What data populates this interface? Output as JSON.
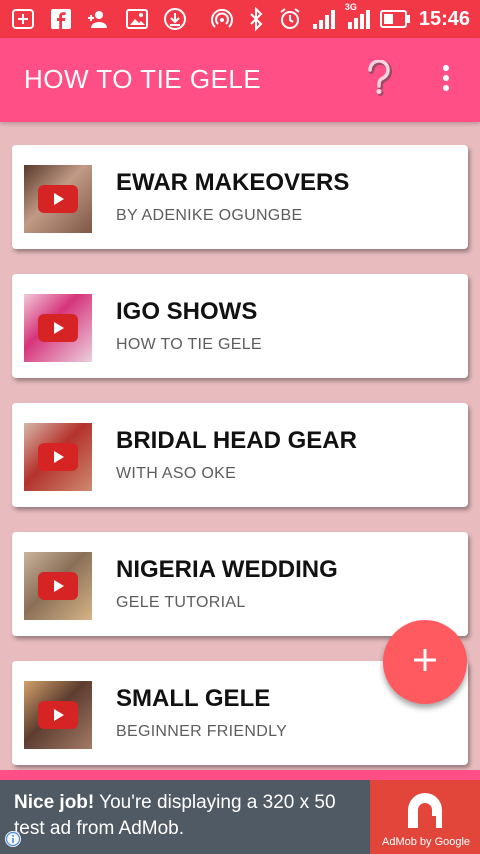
{
  "status_bar": {
    "time": "15:46",
    "network_label": "3G",
    "icons": [
      "add-box-icon",
      "facebook-icon",
      "person-add-icon",
      "image-icon",
      "download-icon",
      "hotspot-icon",
      "bluetooth-icon",
      "alarm-icon",
      "signal-icon",
      "signal-3g-icon",
      "battery-icon"
    ]
  },
  "app_bar": {
    "title": "HOW TO TIE GELE",
    "help_icon": "help-icon",
    "more_icon": "more-vert-icon"
  },
  "videos": [
    {
      "title": "EWAR MAKEOVERS",
      "subtitle": "BY ADENIKE OGUNGBE",
      "thumb_color": "#8a6a5a"
    },
    {
      "title": "IGO SHOWS",
      "subtitle": "HOW TO TIE GELE",
      "thumb_color": "#d24a8a"
    },
    {
      "title": "BRIDAL HEAD GEAR",
      "subtitle": "WITH ASO OKE",
      "thumb_color": "#b8463a"
    },
    {
      "title": "NIGERIA WEDDING",
      "subtitle": "GELE TUTORIAL",
      "thumb_color": "#a08060"
    },
    {
      "title": "SMALL GELE",
      "subtitle": "BEGINNER FRIENDLY",
      "thumb_color": "#7a5a48"
    }
  ],
  "fab": {
    "icon": "plus-icon"
  },
  "ad": {
    "headline": "Nice job!",
    "body": " You're displaying a 320 x 50 test ad from AdMob.",
    "brand": "AdMob by Google",
    "info_icon": "info-icon"
  },
  "colors": {
    "status_bar": "#f23847",
    "app_bar": "#ff4f86",
    "background": "#e8bcbf",
    "fab": "#ff5a5f",
    "ad_background": "#505a64",
    "ad_logo": "#e2463b"
  }
}
